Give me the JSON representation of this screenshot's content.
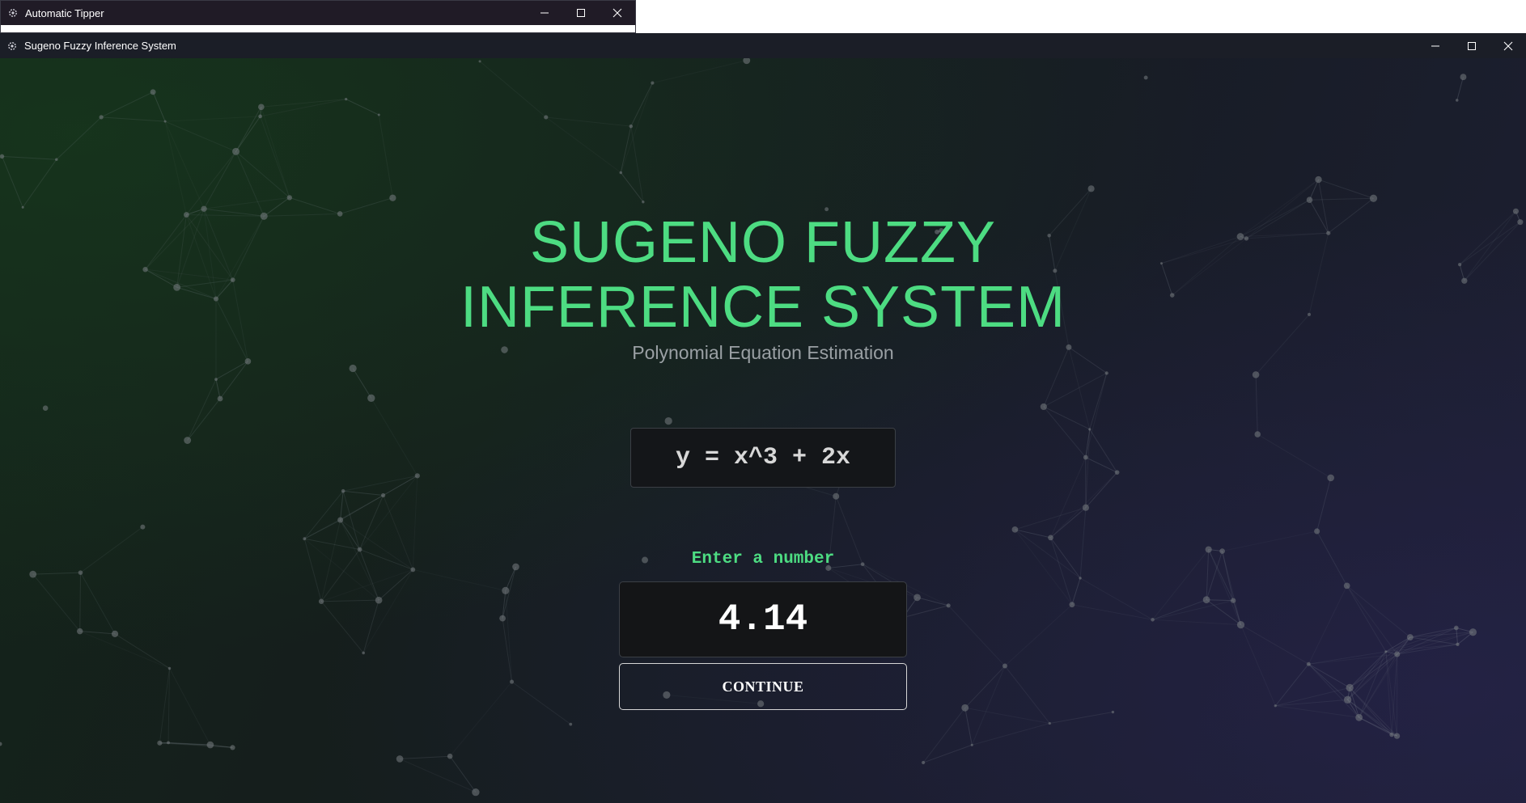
{
  "background_window": {
    "title": "Automatic Tipper",
    "icon": "gear-icon",
    "controls": [
      "minimize-icon",
      "maximize-icon",
      "close-icon"
    ]
  },
  "main_window": {
    "title": "Sugeno Fuzzy Inference System",
    "icon": "gear-icon",
    "controls": [
      "minimize-icon",
      "maximize-icon",
      "close-icon"
    ]
  },
  "page": {
    "title_line1": "SUGENO FUZZY",
    "title_line2": "INFERENCE SYSTEM",
    "subtitle": "Polynomial Equation Estimation",
    "equation": "y = x^3 + 2x",
    "prompt": "Enter a number",
    "input_value": "4.14",
    "continue_label": "CONTINUE"
  },
  "colors": {
    "accent": "#4ddc82",
    "subtitle": "#9aa0a4",
    "titlebar": "#1b1e27",
    "background_start": "#14251a",
    "background_end": "#1d1f33"
  }
}
